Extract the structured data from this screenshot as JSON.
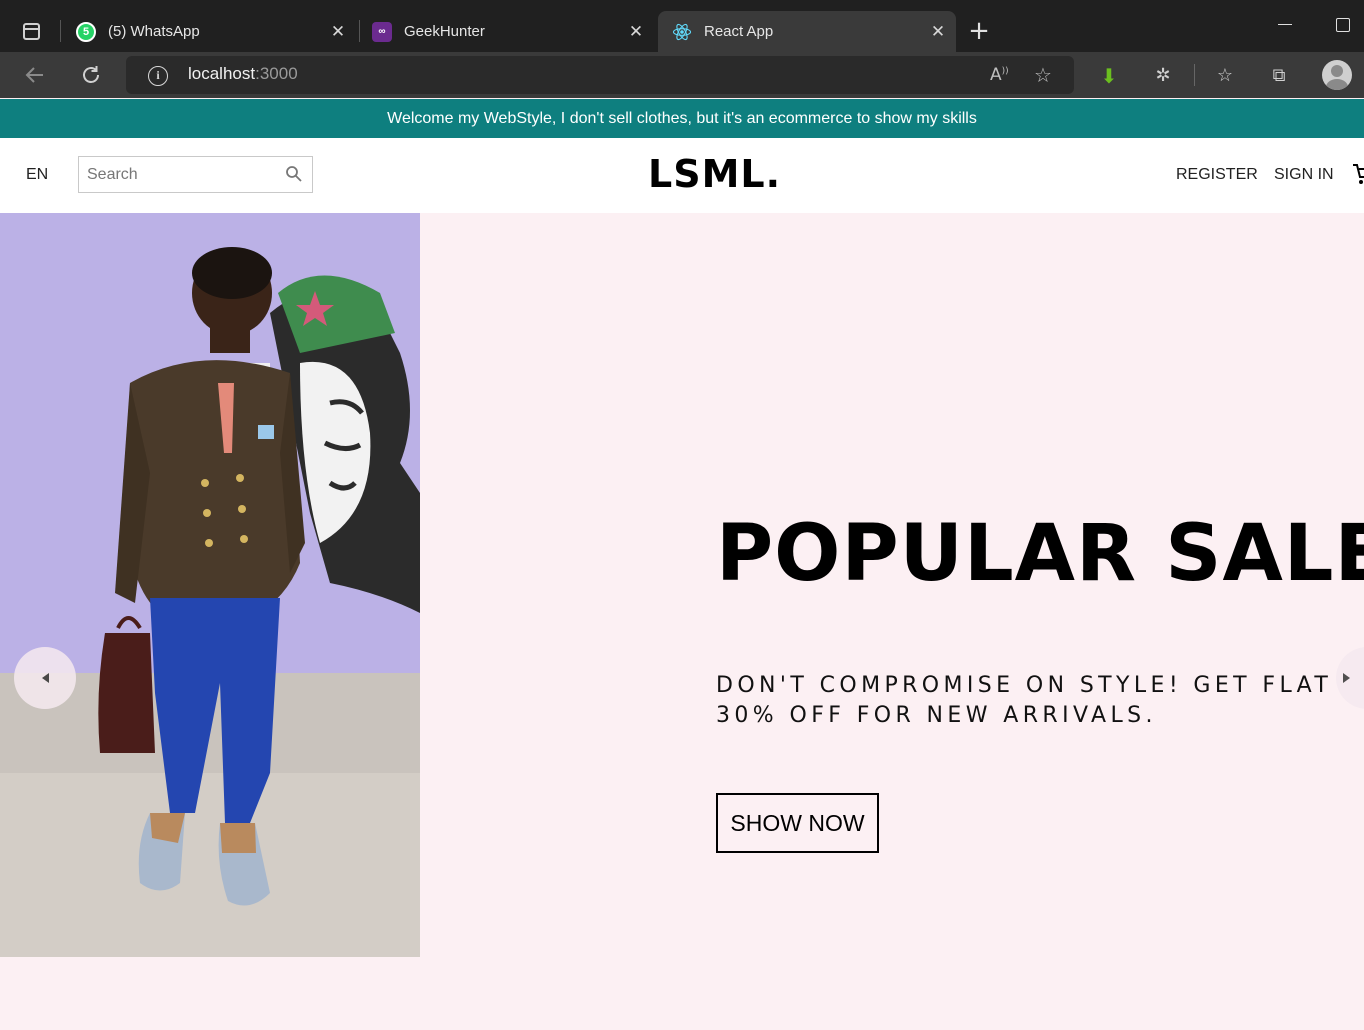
{
  "browser": {
    "tabs": [
      {
        "title": "(5) WhatsApp",
        "badge": "5",
        "icon": "whatsapp-icon",
        "active": false
      },
      {
        "title": "GeekHunter",
        "badge": "",
        "icon": "geekhunter-icon",
        "active": false
      },
      {
        "title": "React App",
        "badge": "",
        "icon": "react-icon",
        "active": true
      }
    ],
    "url_host": "localhost",
    "url_port": ":3000"
  },
  "page": {
    "announcement": "Welcome my WebStyle, I don't sell clothes, but it's an ecommerce to show my skills",
    "nav": {
      "language": "EN",
      "search_placeholder": "Search",
      "logo": "LSML.",
      "register": "REGISTER",
      "sign_in": "SIGN IN"
    },
    "slide": {
      "title": "POPULAR SALE",
      "description": "DON'T COMPROMISE ON STYLE! GET FLAT 30% OFF FOR NEW ARRIVALS.",
      "button": "SHOW NOW",
      "background": "#fcf0f3"
    }
  },
  "colors": {
    "accent": "#0e7f7f",
    "browser_dark": "#202020"
  }
}
